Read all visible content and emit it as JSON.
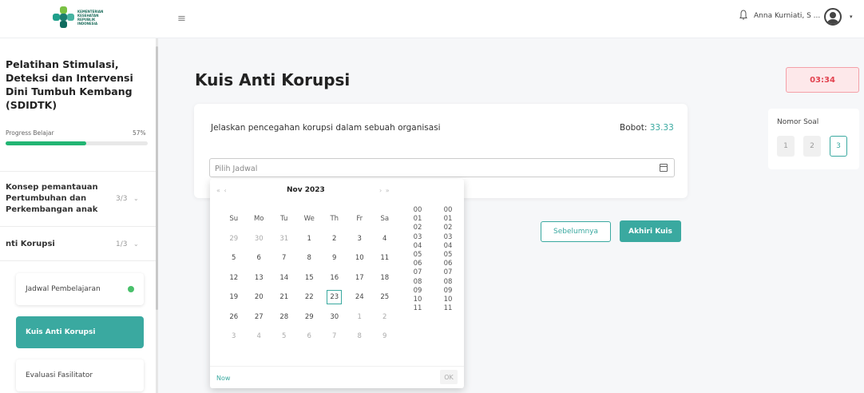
{
  "header": {
    "logo_text": "KEMENTERIAN KESEHATAN REPUBLIK INDONESIA",
    "menu_icon": "hamburger-icon",
    "bell_icon": "bell-icon",
    "user_name": "Anna Kurniati, S ...",
    "avatar_icon": "user-avatar-icon",
    "caret": "▾"
  },
  "sidebar": {
    "course_title": "Pelatihan Stimulasi, Deteksi dan Intervensi Dini Tumbuh Kembang (SDIDTK)",
    "progress_label": "Progress Belajar",
    "progress_pct": "57%",
    "progress_value": 57,
    "modules": [
      {
        "title": "Konsep pemantauan Pertumbuhan dan Perkembangan anak",
        "count": "3/3"
      },
      {
        "title": "nti Korupsi",
        "count": "1/3"
      }
    ],
    "items": [
      {
        "label": "Jadwal Pembelajaran",
        "done": true
      },
      {
        "label": "Kuis Anti Korupsi",
        "active": true
      },
      {
        "label": "Evaluasi Fasilitator"
      }
    ]
  },
  "main": {
    "title": "Kuis Anti Korupsi",
    "question": "Jelaskan pencegahan korupsi dalam sebuah organisasi",
    "bobot_label": "Bobot:",
    "bobot_value": "33.33",
    "date_placeholder": "Pilih Jadwal",
    "prev_label": "Sebelumnya",
    "end_label": "Akhiri Kuis"
  },
  "right": {
    "timer": "03:34",
    "nomor_title": "Nomor Soal",
    "questions": [
      "1",
      "2",
      "3"
    ],
    "current": "3"
  },
  "picker": {
    "prev_nav": "« ‹",
    "month_year": "Nov  2023",
    "next_nav": "› »",
    "weekdays": [
      "Su",
      "Mo",
      "Tu",
      "We",
      "Th",
      "Fr",
      "Sa"
    ],
    "weeks": [
      [
        "29",
        "30",
        "31",
        "1",
        "2",
        "3",
        "4"
      ],
      [
        "5",
        "6",
        "7",
        "8",
        "9",
        "10",
        "11"
      ],
      [
        "12",
        "13",
        "14",
        "15",
        "16",
        "17",
        "18"
      ],
      [
        "19",
        "20",
        "21",
        "22",
        "23",
        "24",
        "25"
      ],
      [
        "26",
        "27",
        "28",
        "29",
        "30",
        "1",
        "2"
      ],
      [
        "3",
        "4",
        "5",
        "6",
        "7",
        "8",
        "9"
      ]
    ],
    "selected_day": "23",
    "hours": [
      "00",
      "01",
      "02",
      "03",
      "04",
      "05",
      "06",
      "07",
      "08",
      "09",
      "10",
      "11"
    ],
    "minutes": [
      "00",
      "01",
      "02",
      "03",
      "04",
      "05",
      "06",
      "07",
      "08",
      "09",
      "10",
      "11"
    ],
    "now_label": "Now",
    "ok_label": "OK"
  }
}
